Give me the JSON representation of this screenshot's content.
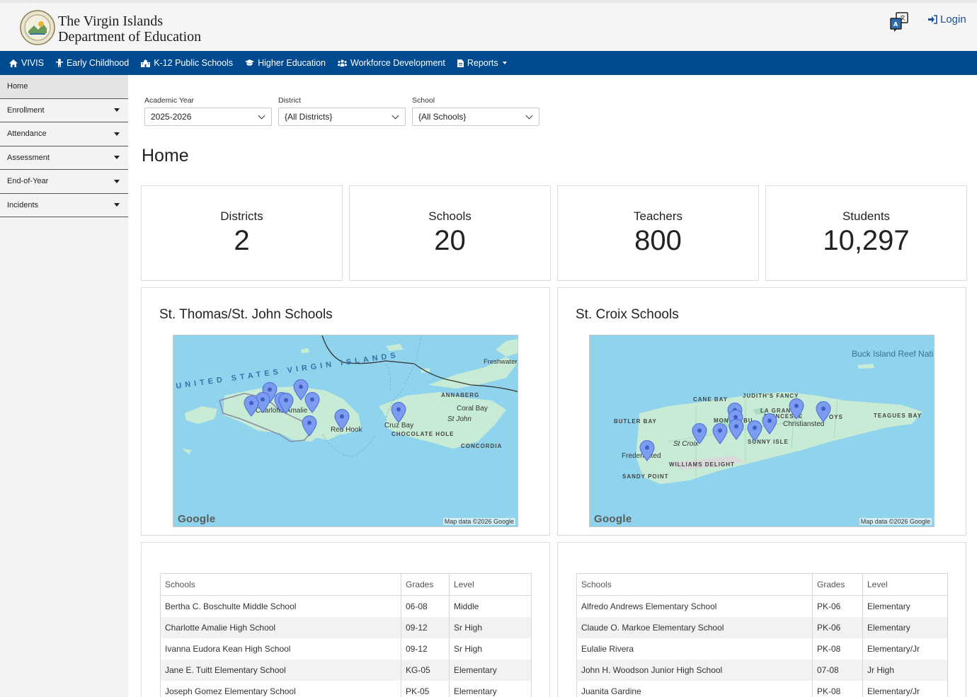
{
  "header": {
    "brand_line1": "The Virgin Islands",
    "brand_line2": "Department of Education",
    "login_label": "Login"
  },
  "nav": [
    {
      "label": "VIVIS",
      "icon": "home-icon"
    },
    {
      "label": "Early Childhood",
      "icon": "child-icon"
    },
    {
      "label": "K-12 Public Schools",
      "icon": "school-icon"
    },
    {
      "label": "Higher Education",
      "icon": "graduation-cap-icon"
    },
    {
      "label": "Workforce Development",
      "icon": "users-icon"
    },
    {
      "label": "Reports",
      "icon": "file-icon"
    }
  ],
  "sidebar": {
    "items": [
      {
        "label": "Home"
      },
      {
        "label": "Enrollment"
      },
      {
        "label": "Attendance"
      },
      {
        "label": "Assessment"
      },
      {
        "label": "End-of-Year"
      },
      {
        "label": "Incidents"
      }
    ]
  },
  "filters": {
    "academic_year": {
      "label": "Academic Year",
      "value": "2025-2026"
    },
    "district": {
      "label": "District",
      "value": "{All Districts}"
    },
    "school": {
      "label": "School",
      "value": "{All Schools}"
    }
  },
  "page_title": "Home",
  "stats": [
    {
      "label": "Districts",
      "value": "2"
    },
    {
      "label": "Schools",
      "value": "20"
    },
    {
      "label": "Teachers",
      "value": "800"
    },
    {
      "label": "Students",
      "value": "10,297"
    }
  ],
  "maps": {
    "stt": {
      "title": "St. Thomas/St. John Schools",
      "labels": {
        "usvi": "UNITED STATES VIRGIN ISLANDS",
        "freshwater": "Freshwater Pond",
        "annaberg": "ANNABERG",
        "coral_bay": "Coral Bay",
        "st_john": "St John",
        "concordia": "CONCORDIA",
        "charlotte": "Charlotte Amalie",
        "red_hook": "Red Hook",
        "cruz_bay": "Cruz Bay",
        "chocolate": "CHOCOLATE HOLE"
      }
    },
    "stx": {
      "title": "St. Croix Schools",
      "labels": {
        "buck_island": "Buck Island Reef National Monument",
        "judiths": "JUDITH'S FANCY",
        "cane_bay": "CANE BAY",
        "la_grange": "LA GRANGE",
        "princesse": "PRINCESSE",
        "teagues": "TEAGUES BAY",
        "butler": "BUTLER BAY",
        "christiansted": "Christiansted",
        "st_croix": "St Croix",
        "sunny_isle": "SUNNY ISLE",
        "frederiksted": "Frederiksted",
        "williams": "WILLIAMS DELIGHT",
        "sandy_point": "SANDY POINT",
        "mon": "MON",
        "bu": "BU",
        "oys": "OYS"
      }
    },
    "google_label": "Google",
    "attribution": "Map data ©2026 Google"
  },
  "tables": {
    "columns": [
      "Schools",
      "Grades",
      "Level"
    ],
    "stt_rows": [
      [
        "Bertha C. Boschulte Middle School",
        "06-08",
        "Middle"
      ],
      [
        "Charlotte Amalie High School",
        "09-12",
        "Sr High"
      ],
      [
        "Ivanna Eudora Kean High School",
        "09-12",
        "Sr High"
      ],
      [
        "Jane E. Tuitt Elementary School",
        "KG-05",
        "Elementary"
      ],
      [
        "Joseph Gomez Elementary School",
        "PK-05",
        "Elementary"
      ]
    ],
    "stx_rows": [
      [
        "Alfredo Andrews Elementary School",
        "PK-06",
        "Elementary"
      ],
      [
        "Claude O. Markoe Elementary School",
        "PK-06",
        "Elementary"
      ],
      [
        "Eulalie Rivera",
        "PK-08",
        "Elementary/Jr"
      ],
      [
        "John H. Woodson Junior High School",
        "07-08",
        "Jr High"
      ],
      [
        "Juanita Gardine",
        "PK-08",
        "Elementary/Jr"
      ]
    ]
  },
  "colors": {
    "nav_bg": "#004a8f",
    "map_water": "#8fd4ec",
    "map_land": "#c8ebd6",
    "pin": "#7b9cf0"
  }
}
